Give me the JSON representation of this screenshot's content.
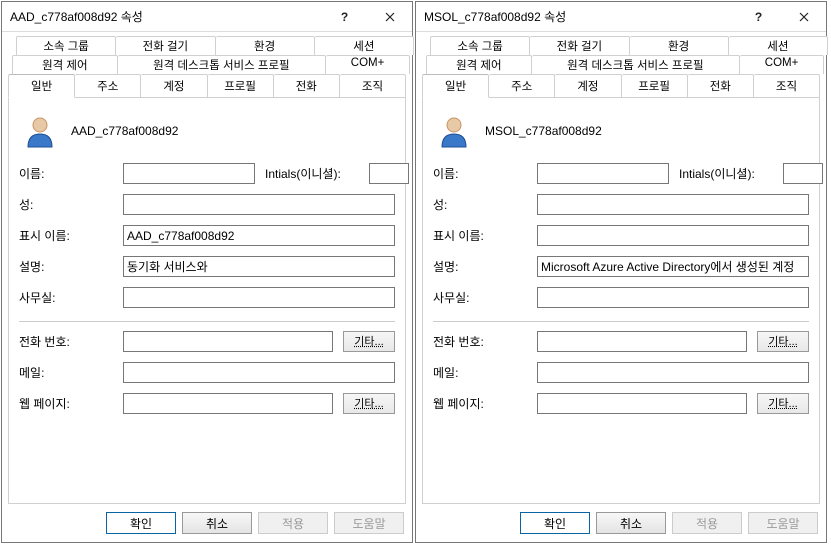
{
  "dialogs": [
    {
      "title": "AAD_c778af008d92 속성",
      "identity_name": "AAD_c778af008d92",
      "fields": {
        "firstname_label": "이름:",
        "firstname": "",
        "initials_label": "Intials(이니셜):",
        "initials": "",
        "lastname_label": "성:",
        "lastname": "",
        "display_label": "표시 이름:",
        "display": "AAD_c778af008d92",
        "description_label": "설명:",
        "description": "동기화 서비스와",
        "office_label": "사무실:",
        "office": "",
        "phone_label": "전화 번호:",
        "phone": "",
        "mail_label": "메일:",
        "mail": "",
        "web_label": "웹 페이지:",
        "web": ""
      }
    },
    {
      "title": "MSOL_c778af008d92 속성",
      "identity_name": "MSOL_c778af008d92",
      "fields": {
        "firstname_label": "이름:",
        "firstname": "",
        "initials_label": "Intials(이니셜):",
        "initials": "",
        "lastname_label": "성:",
        "lastname": "",
        "display_label": "표시 이름:",
        "display": "",
        "description_label": "설명:",
        "description": "Microsoft Azure Active Directory에서 생성된 계정",
        "office_label": "사무실:",
        "office": "",
        "phone_label": "전화 번호:",
        "phone": "",
        "mail_label": "메일:",
        "mail": "",
        "web_label": "웹 페이지:",
        "web": ""
      }
    }
  ],
  "tabs": {
    "row1": [
      "소속 그룹",
      "전화 걸기",
      "환경",
      "세션"
    ],
    "row2": [
      "원격 제어",
      "원격 데스크톱 서비스 프로필",
      "COM+"
    ],
    "row3": [
      "일반",
      "주소",
      "계정",
      "프로필",
      "전화",
      "조직"
    ],
    "active": "일반"
  },
  "buttons": {
    "other": "기타...",
    "ok": "확인",
    "cancel": "취소",
    "apply": "적용",
    "help": "도움말"
  }
}
